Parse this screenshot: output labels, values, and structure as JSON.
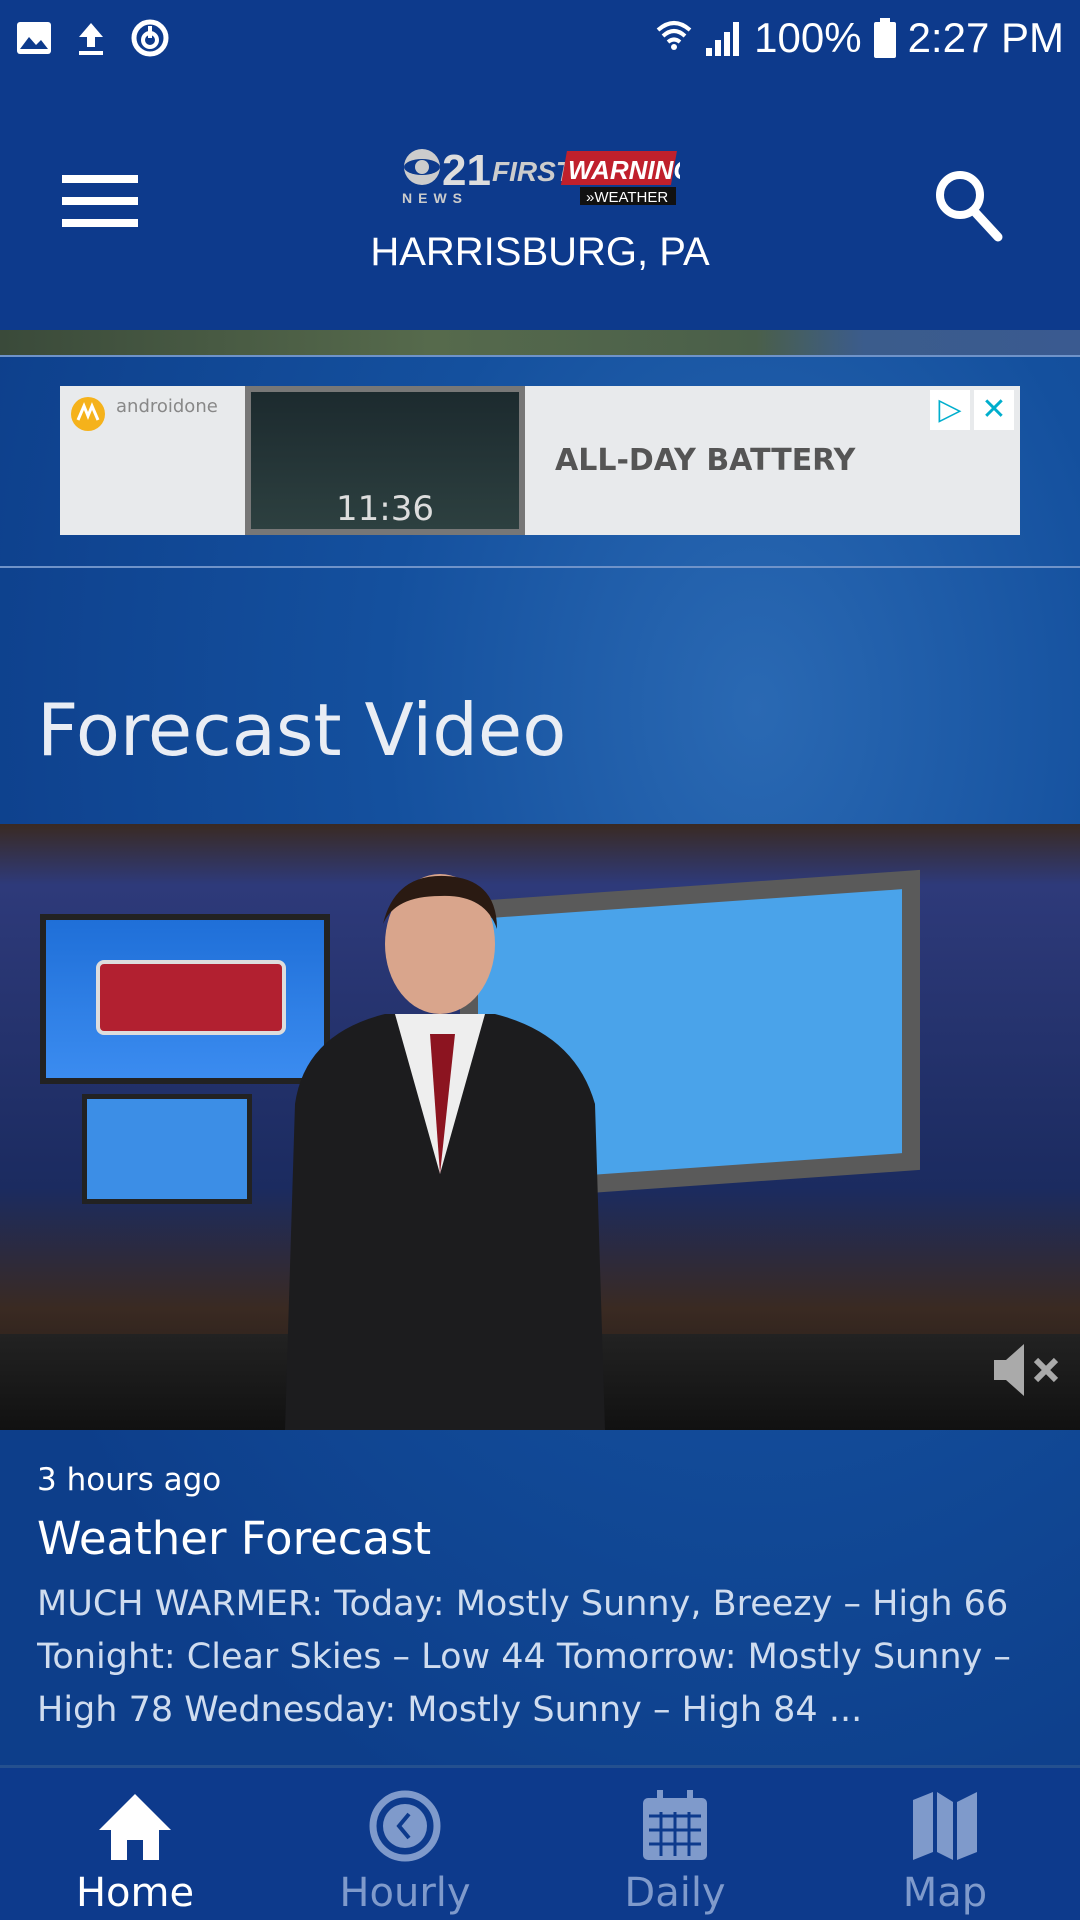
{
  "status_bar": {
    "battery": "100%",
    "time": "2:27 PM",
    "icons": [
      "image-icon",
      "upload-icon",
      "sync-icon",
      "wifi-icon",
      "signal-icon",
      "battery-icon"
    ]
  },
  "header": {
    "logo_text": "CBS 21 NEWS FIRST WARNING WEATHER",
    "location": "HARRISBURG, PA",
    "menu_icon": "hamburger-icon",
    "search_icon": "search-icon"
  },
  "ad": {
    "brand": "androidone",
    "headline": "ALL-DAY BATTERY",
    "phone_time": "11:36"
  },
  "section": {
    "title": "Forecast Video"
  },
  "video": {
    "muted": true,
    "age": "3 hours ago",
    "title": "Weather Forecast",
    "description": "MUCH WARMER: Today: Mostly Sunny, Breezy – High 66 Tonight: Clear Skies – Low 44 Tomorrow: Mostly Sunny – High 78 Wednesday: Mostly Sunny – High 84 ..."
  },
  "nav": {
    "items": [
      {
        "label": "Home",
        "icon": "home-icon",
        "active": true
      },
      {
        "label": "Hourly",
        "icon": "clock-icon"
      },
      {
        "label": "Daily",
        "icon": "calendar-icon"
      },
      {
        "label": "Map",
        "icon": "map-icon"
      }
    ]
  },
  "colors": {
    "primary": "#0d3a8c",
    "inactive": "#7f9acb",
    "logo_red": "#c0202c"
  }
}
